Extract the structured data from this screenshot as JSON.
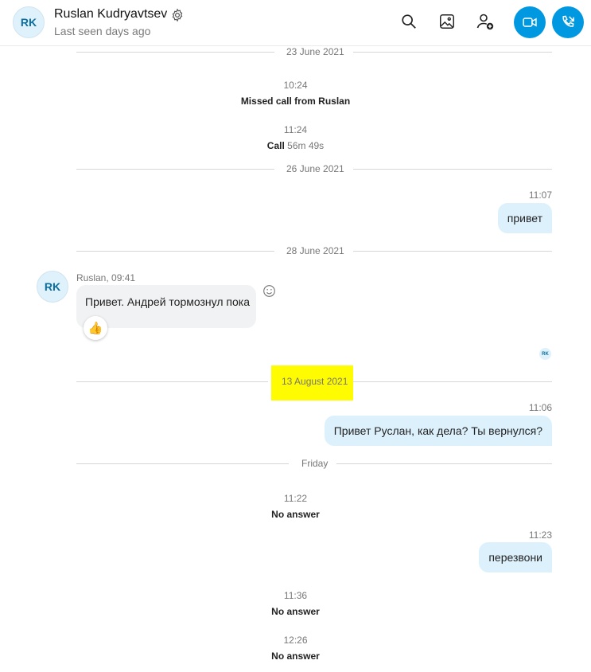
{
  "header": {
    "avatar_initials": "RK",
    "contact_name": "Ruslan Kudryavtsev",
    "last_seen": "Last seen days ago",
    "icons": [
      "gear-icon",
      "search-icon",
      "gallery-icon",
      "add-person-icon",
      "video-call-icon",
      "phone-call-icon"
    ],
    "accent_color": "#0098e0"
  },
  "dates": {
    "d1": "23 June 2021",
    "d2": "26 June 2021",
    "d3": "28 June 2021",
    "d4": "13 August 2021",
    "d5": "Friday"
  },
  "events": {
    "missed_time": "10:24",
    "missed_text": "Missed call from Ruslan",
    "call_time": "11:24",
    "call_label": "Call",
    "call_duration": "56m 49s",
    "noanswer1_time": "11:22",
    "noanswer1_text": "No answer",
    "noanswer2_time": "11:36",
    "noanswer2_text": "No answer",
    "noanswer3_time": "12:26",
    "noanswer3_text": "No answer"
  },
  "messages": {
    "out1_time": "11:07",
    "out1_text": "привет",
    "in1_sender": "Ruslan, 09:41",
    "in1_avatar": "RK",
    "in1_text": "Привет. Андрей тормознул пока",
    "in1_reaction": "👍",
    "read_receipt": "RK",
    "out2_time": "11:06",
    "out2_text": "Привет Руслан, как дела? Ты вернулся?",
    "out3_time": "11:23",
    "out3_text": "перезвони"
  },
  "highlight_color": "#fffb00"
}
